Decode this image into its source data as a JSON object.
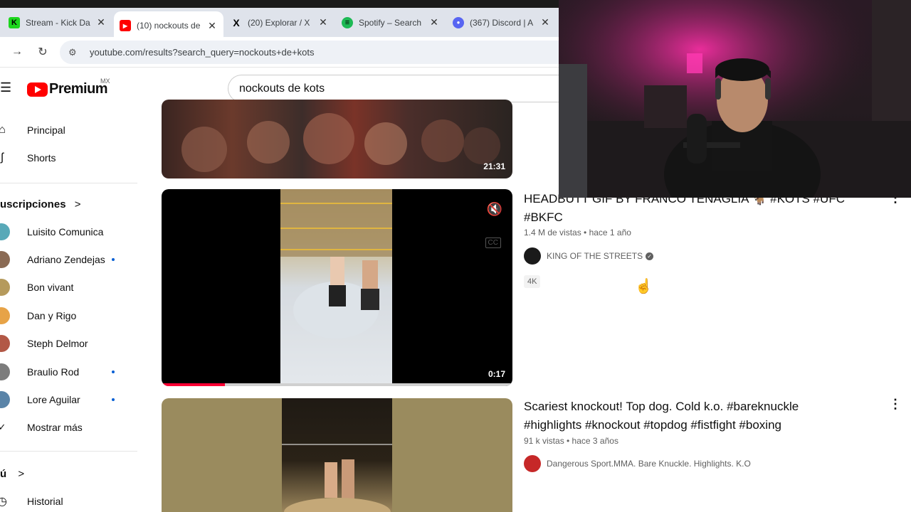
{
  "tabs": [
    {
      "title": "Stream - Kick Da",
      "close": "✕",
      "fav_bg": "#1dd61d",
      "fav_letter": "K",
      "fav_color": "#000"
    },
    {
      "title": "(10) nockouts de",
      "close": "✕",
      "fav_bg": "#ff0000",
      "fav_letter": "▶",
      "fav_color": "#fff",
      "active": true
    },
    {
      "title": "(20) Explorar / X",
      "close": "✕",
      "fav_bg": "#000000",
      "fav_letter": "X",
      "fav_color": "#fff"
    },
    {
      "title": "Spotify – Search",
      "close": "✕",
      "fav_bg": "#1db954",
      "fav_letter": "≡",
      "fav_color": "#000"
    },
    {
      "title": "(367) Discord | A",
      "close": "✕",
      "fav_bg": "#5865f2",
      "fav_letter": "●",
      "fav_color": "#fff"
    }
  ],
  "address": {
    "url": "youtube.com/results?search_query=nockouts+de+kots",
    "back_icon": "→",
    "reload_icon": "↻",
    "tune_icon": "⚙"
  },
  "header": {
    "logo_word": "Premium",
    "country": "MX",
    "search_value": "nockouts de kots"
  },
  "sidebar": {
    "main": [
      {
        "label": "Principal",
        "icon": "⌂"
      },
      {
        "label": "Shorts",
        "icon": "ʃ"
      }
    ],
    "subs_title": "uscripciones",
    "subs_chevron": ">",
    "subscriptions": [
      {
        "label": "Luisito Comunica",
        "color": "#58a9b8",
        "dot": false
      },
      {
        "label": "Adriano Zendejas",
        "color": "#8a6a54",
        "dot": true
      },
      {
        "label": "Bon vivant",
        "color": "#b59a5c",
        "dot": false
      },
      {
        "label": "Dan y Rigo",
        "color": "#e7a347",
        "dot": false
      },
      {
        "label": "Steph Delmor",
        "color": "#b25846",
        "dot": false
      },
      {
        "label": "Braulio Rod",
        "color": "#7c7c7c",
        "dot": true
      },
      {
        "label": "Lore Aguilar",
        "color": "#5a84a8",
        "dot": true
      }
    ],
    "more_label": "Mostrar más",
    "more_icon": "✓",
    "you_title": "ú",
    "you_chevron": ">",
    "history_label": "Historial",
    "history_icon": "◷"
  },
  "results": [
    {
      "duration": "21:31"
    },
    {
      "duration": "0:17",
      "title_line1": "HEADBUTT GIF BY FRANCO TENAGLIA 🐐 #KOTS #UFC",
      "title_line2": "#BKFC",
      "meta": "1.4 M de vistas • hace 1 año",
      "channel": "KING OF THE STREETS",
      "verified_icon": "✓",
      "badge": "4K",
      "mute_icon": "🔇",
      "cc_icon": "CC",
      "progress": 0.18,
      "kebab": "⋮"
    },
    {
      "title_line1": "Scariest knockout! Top dog. Cold k.o. #bareknuckle",
      "title_line2": "#highlights #knockout #topdog #fistfight #boxing",
      "meta": "91 k vistas • hace 3 años",
      "channel": "Dangerous Sport.MMA. Bare Knuckle. Highlights. K.O",
      "kebab": "⋮"
    }
  ],
  "cursor_icon": "☝"
}
